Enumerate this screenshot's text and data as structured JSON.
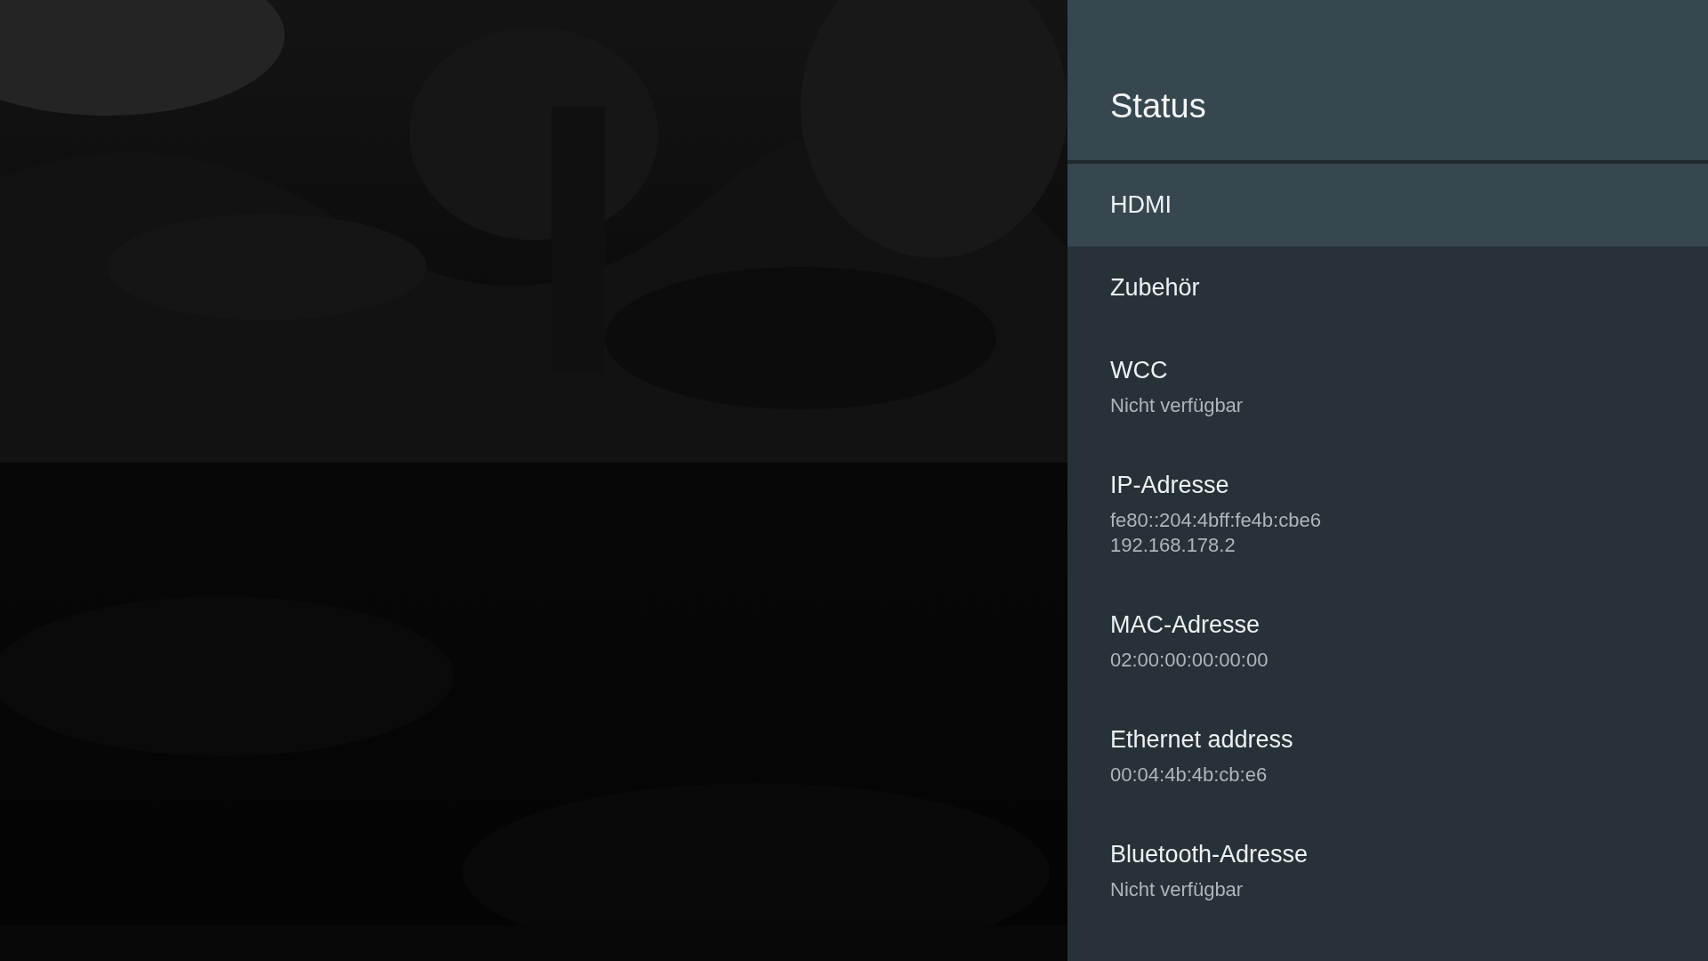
{
  "panel": {
    "title": "Status",
    "items": [
      {
        "title": "HDMI",
        "selected": true
      },
      {
        "title": "Zubehör",
        "selected": false
      },
      {
        "title": "WCC",
        "summary": [
          "Nicht verfügbar"
        ],
        "selected": false
      },
      {
        "title": "IP-Adresse",
        "summary": [
          "fe80::204:4bff:fe4b:cbe6",
          "192.168.178.2"
        ],
        "selected": false
      },
      {
        "title": "MAC-Adresse",
        "summary": [
          "02:00:00:00:00:00"
        ],
        "selected": false
      },
      {
        "title": "Ethernet address",
        "summary": [
          "00:04:4b:4b:cb:e6"
        ],
        "selected": false
      },
      {
        "title": "Bluetooth-Adresse",
        "summary": [
          "Nicht verfügbar"
        ],
        "selected": false
      }
    ]
  }
}
